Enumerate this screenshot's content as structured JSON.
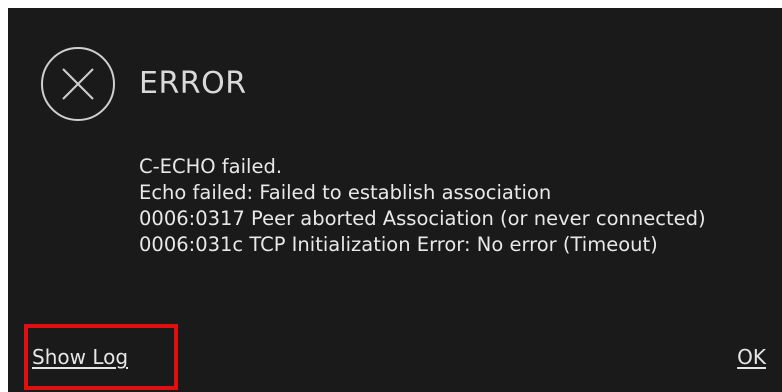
{
  "dialog": {
    "icon": "close-circle-icon",
    "title": "ERROR",
    "message_lines": [
      "C-ECHO failed.",
      "Echo failed: Failed to establish association",
      "0006:0317 Peer aborted Association (or never connected)",
      "0006:031c TCP Initialization Error: No error (Timeout)"
    ],
    "show_log_label": "Show Log",
    "ok_label": "OK"
  },
  "colors": {
    "background": "#1a1a1a",
    "text": "#e6e6e6",
    "highlight": "#e01010"
  }
}
